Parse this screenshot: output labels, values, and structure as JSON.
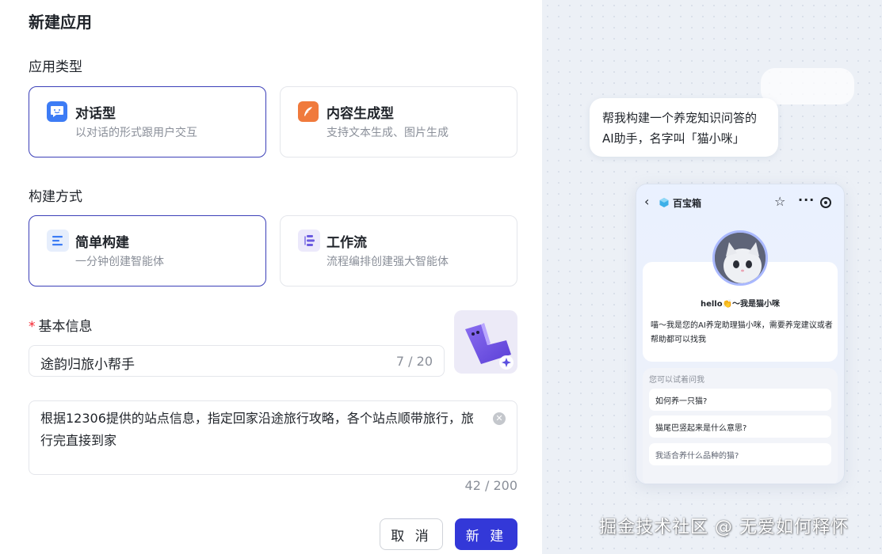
{
  "page": {
    "title": "新建应用"
  },
  "app_type": {
    "label": "应用类型",
    "options": [
      {
        "title": "对话型",
        "desc": "以对话的形式跟用户交互",
        "selected": true,
        "icon": "chat-icon",
        "color": "#3d7cf5"
      },
      {
        "title": "内容生成型",
        "desc": "支持文本生成、图片生成",
        "selected": false,
        "icon": "feather-icon",
        "color": "#f07a3c"
      }
    ]
  },
  "build_mode": {
    "label": "构建方式",
    "options": [
      {
        "title": "简单构建",
        "desc": "一分钟创建智能体",
        "selected": true,
        "icon": "lines-icon",
        "color": "#3d7cf5"
      },
      {
        "title": "工作流",
        "desc": "流程编排创建强大智能体",
        "selected": false,
        "icon": "workflow-icon",
        "color": "#6a5ae0"
      }
    ]
  },
  "basic_info": {
    "label": "基本信息",
    "required_mark": "*",
    "name_value": "途韵归旅小帮手",
    "name_count": "7 / 20",
    "desc_value": "根据12306提供的站点信息，指定回家沿途旅行攻略，各个站点顺带旅行，旅行完直接到家",
    "desc_count": "42 / 200"
  },
  "actions": {
    "cancel": "取 消",
    "create": "新 建"
  },
  "preview": {
    "prompt": "帮我构建一个养宠知识问答的AI助手，名字叫「猫小咪」",
    "phone_title": "百宝箱",
    "hello": "hello👏～我是猫小咪",
    "intro": "喵～我是您的AI养宠助理猫小咪，需要养宠建议或者帮助都可以找我",
    "suggest_head": "您可以试着问我",
    "suggestions": [
      "如何养一只猫?",
      "猫尾巴竖起来是什么意思?",
      "我适合养什么品种的猫?"
    ]
  },
  "watermark": "掘金技术社区 @ 无爱如何释怀",
  "colors": {
    "accent": "#3338d8",
    "selected_border": "#3b3fb8",
    "required": "#f5222d"
  }
}
